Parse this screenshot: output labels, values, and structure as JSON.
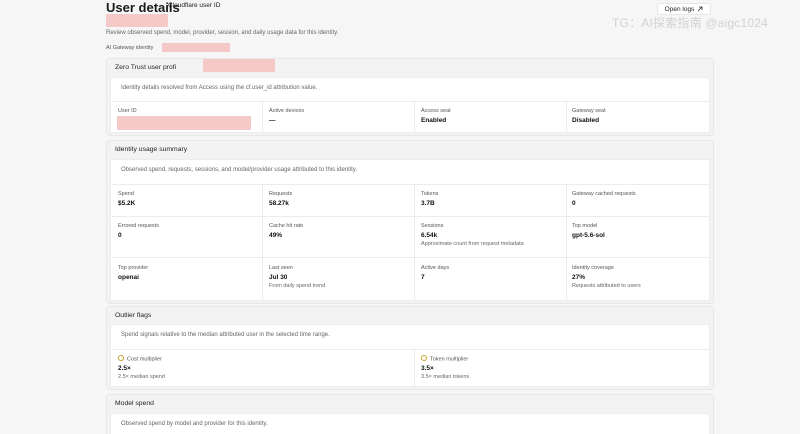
{
  "header": {
    "title": "User details",
    "cloudflare_label": "Cloudflare user ID",
    "subtitle": "Review observed spend, model, provider, session, and daily usage data for this identity.",
    "gateway_label": "AI Gateway identity",
    "open_logs": "Open logs",
    "open_logs_icon": "external-arrow-icon",
    "watermark": "TG：AI探索指南 @aigc1024"
  },
  "zero_trust": {
    "title": "Zero Trust user profi",
    "description": "Identity details resolved from Access using the cf.user_id attribution value.",
    "fields": [
      {
        "label": "User ID",
        "value": ""
      },
      {
        "label": "Active devices",
        "value": "—"
      },
      {
        "label": "Access seat",
        "value": "Enabled"
      },
      {
        "label": "Gateway seat",
        "value": "Disabled"
      }
    ]
  },
  "usage": {
    "title": "Identity usage summary",
    "description": "Observed spend, requests, sessions, and model/provider usage attributed to this identity.",
    "rows": [
      [
        {
          "label": "Spend",
          "value": "$5.2K",
          "sub": ""
        },
        {
          "label": "Requests",
          "value": "58.27k",
          "sub": ""
        },
        {
          "label": "Tokens",
          "value": "3.7B",
          "sub": ""
        },
        {
          "label": "Gateway cached requests",
          "value": "0",
          "sub": ""
        }
      ],
      [
        {
          "label": "Errored requests",
          "value": "0",
          "sub": ""
        },
        {
          "label": "Cache hit rate",
          "value": "49%",
          "sub": ""
        },
        {
          "label": "Sessions",
          "value": "6.54k",
          "sub": "Approximate count from request metadata"
        },
        {
          "label": "Top model",
          "value": "gpt-5.6-sol",
          "sub": ""
        }
      ],
      [
        {
          "label": "Top provider",
          "value": "openai",
          "sub": ""
        },
        {
          "label": "Last seen",
          "value": "Jul 30",
          "sub": "From daily spend trend"
        },
        {
          "label": "Active days",
          "value": "7",
          "sub": ""
        },
        {
          "label": "Identity coverage",
          "value": "27%",
          "sub": "Requests attributed to users"
        }
      ]
    ]
  },
  "outliers": {
    "title": "Outlier flags",
    "description": "Spend signals relative to the median attributed user in the selected time range.",
    "flags": [
      {
        "label": "Cost multiplier",
        "value": "2.5×",
        "sub": "2.5× median spend",
        "icon": "warning-circle-icon"
      },
      {
        "label": "Token multiplier",
        "value": "3.5×",
        "sub": "3.5× median tokens",
        "icon": "warning-circle-icon"
      }
    ]
  },
  "model_spend": {
    "title": "Model spend",
    "description": "Observed spend by model and provider for this identity."
  }
}
